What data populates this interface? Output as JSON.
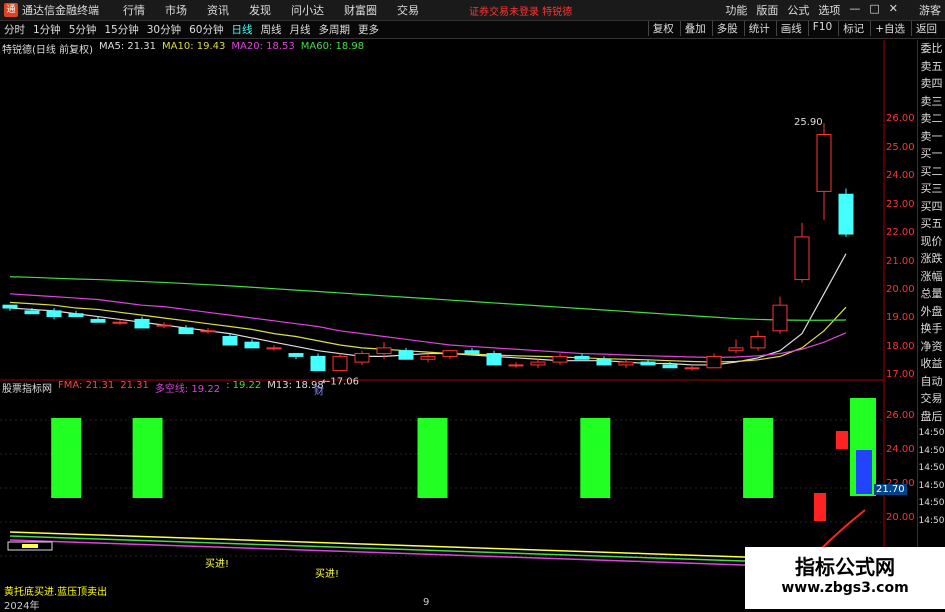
{
  "app": {
    "title": "通达信金融终端",
    "warning": "证券交易未登录 特锐德"
  },
  "menu": [
    "行情",
    "市场",
    "资讯",
    "发现",
    "问小达",
    "财富圈",
    "交易"
  ],
  "top_right": [
    "功能",
    "版面",
    "公式",
    "选项"
  ],
  "top_right_extra": "游客",
  "periods": [
    "分时",
    "1分钟",
    "5分钟",
    "15分钟",
    "30分钟",
    "60分钟",
    "日线",
    "周线",
    "月线",
    "多周期",
    "更多"
  ],
  "active_period": "日线",
  "tools": [
    "复权",
    "叠加",
    "多股",
    "统计",
    "画线",
    "F10",
    "标记",
    "+自选",
    "返回"
  ],
  "main_legend": {
    "name": "特锐德(日线 前复权)",
    "ma5": "MA5: 21.31",
    "ma10": "MA10: 19.43",
    "ma20": "MA20: 18.53",
    "ma60": "MA60: 18.98"
  },
  "sub_legend": {
    "name": "股票指标网",
    "fma": "FMA: 21.31",
    "v2": "21.31",
    "dk": "多空线: 19.22",
    "v4": ": 19.22",
    "m13": "M13: 18.98"
  },
  "price_ticks": [
    "26.00",
    "25.00",
    "24.00",
    "23.00",
    "22.00",
    "21.00",
    "20.00",
    "19.00",
    "18.00",
    "17.00"
  ],
  "sub_ticks": [
    "26.00",
    "24.00",
    "22.00",
    "20.00"
  ],
  "sub_current": "21.70",
  "side_items": [
    "委比",
    "卖五",
    "卖四",
    "卖三",
    "卖二",
    "卖一",
    "买一",
    "买二",
    "买三",
    "买四",
    "买五",
    "现价",
    "涨跌",
    "涨幅",
    "总量",
    "外盘",
    "换手",
    "净资",
    "收益",
    "自动",
    "交易",
    "盘后",
    "14:50",
    "14:50",
    "14:50",
    "14:50",
    "14:50",
    "14:50"
  ],
  "annotations": {
    "high": "25.90",
    "low": "17.06",
    "buy1": "买进!",
    "buy2": "买进!",
    "cai": "财"
  },
  "bottom_note": "黄托底买进.蓝压顶卖出",
  "dates": {
    "left": "2024年",
    "mid": "9"
  },
  "watermark": {
    "line1": "指标公式网",
    "line2": "www.zbgs3.com"
  },
  "chart_data": {
    "type": "candlestick",
    "ylim": [
      16.8,
      28.4
    ],
    "candles": [
      [
        19.5,
        19.5,
        19.3,
        19.4
      ],
      [
        19.3,
        19.4,
        19.2,
        19.2
      ],
      [
        19.3,
        19.4,
        19.0,
        19.1
      ],
      [
        19.2,
        19.3,
        19.1,
        19.1
      ],
      [
        19.0,
        19.1,
        18.9,
        18.9
      ],
      [
        18.9,
        19.0,
        18.8,
        18.9
      ],
      [
        19.0,
        19.1,
        18.7,
        18.7
      ],
      [
        18.8,
        18.9,
        18.7,
        18.8
      ],
      [
        18.7,
        18.8,
        18.5,
        18.5
      ],
      [
        18.6,
        18.7,
        18.5,
        18.6
      ],
      [
        18.4,
        18.5,
        18.1,
        18.1
      ],
      [
        18.2,
        18.3,
        18.0,
        18.0
      ],
      [
        18.0,
        18.1,
        17.9,
        18.0
      ],
      [
        17.8,
        17.8,
        17.6,
        17.7
      ],
      [
        17.7,
        17.8,
        17.2,
        17.2
      ],
      [
        17.2,
        17.8,
        17.2,
        17.7
      ],
      [
        17.5,
        17.9,
        17.4,
        17.8
      ],
      [
        17.8,
        18.2,
        17.6,
        18.0
      ],
      [
        17.9,
        18.0,
        17.6,
        17.6
      ],
      [
        17.6,
        17.8,
        17.5,
        17.7
      ],
      [
        17.7,
        17.9,
        17.6,
        17.9
      ],
      [
        17.9,
        18.0,
        17.8,
        17.8
      ],
      [
        17.8,
        17.9,
        17.4,
        17.4
      ],
      [
        17.4,
        17.5,
        17.3,
        17.4
      ],
      [
        17.4,
        17.6,
        17.3,
        17.5
      ],
      [
        17.5,
        17.8,
        17.4,
        17.7
      ],
      [
        17.7,
        17.8,
        17.6,
        17.6
      ],
      [
        17.6,
        17.7,
        17.4,
        17.4
      ],
      [
        17.4,
        17.6,
        17.3,
        17.5
      ],
      [
        17.5,
        17.6,
        17.4,
        17.4
      ],
      [
        17.4,
        17.5,
        17.3,
        17.3
      ],
      [
        17.3,
        17.4,
        17.2,
        17.3
      ],
      [
        17.3,
        17.8,
        17.3,
        17.7
      ],
      [
        17.9,
        18.3,
        17.8,
        18.0
      ],
      [
        18.0,
        18.6,
        17.9,
        18.4
      ],
      [
        18.6,
        19.8,
        18.5,
        19.5
      ],
      [
        20.4,
        22.4,
        20.3,
        21.9
      ],
      [
        23.5,
        25.9,
        22.5,
        25.5
      ],
      [
        23.4,
        23.6,
        21.9,
        22.0
      ]
    ],
    "ma_series": [
      {
        "name": "MA5",
        "color": "#dddddd",
        "values": [
          19.4,
          19.35,
          19.3,
          19.2,
          19.1,
          19.0,
          18.9,
          18.8,
          18.7,
          18.6,
          18.5,
          18.35,
          18.2,
          18.05,
          17.9,
          17.8,
          17.7,
          17.7,
          17.75,
          17.8,
          17.8,
          17.75,
          17.7,
          17.65,
          17.6,
          17.55,
          17.55,
          17.55,
          17.5,
          17.45,
          17.45,
          17.4,
          17.4,
          17.5,
          17.65,
          17.9,
          18.5,
          19.9,
          21.31
        ]
      },
      {
        "name": "MA10",
        "color": "#dddd44",
        "values": [
          19.6,
          19.55,
          19.5,
          19.4,
          19.35,
          19.25,
          19.15,
          19.05,
          18.95,
          18.85,
          18.75,
          18.65,
          18.5,
          18.4,
          18.25,
          18.1,
          18.0,
          17.95,
          17.9,
          17.85,
          17.8,
          17.78,
          17.75,
          17.72,
          17.7,
          17.68,
          17.65,
          17.62,
          17.6,
          17.58,
          17.55,
          17.52,
          17.5,
          17.52,
          17.58,
          17.7,
          18.0,
          18.6,
          19.43
        ]
      },
      {
        "name": "MA20",
        "color": "#dd44dd",
        "values": [
          19.9,
          19.85,
          19.8,
          19.75,
          19.7,
          19.6,
          19.5,
          19.45,
          19.35,
          19.25,
          19.15,
          19.05,
          18.95,
          18.85,
          18.75,
          18.6,
          18.5,
          18.4,
          18.3,
          18.2,
          18.1,
          18.05,
          18.0,
          17.95,
          17.9,
          17.85,
          17.8,
          17.78,
          17.75,
          17.72,
          17.7,
          17.68,
          17.66,
          17.68,
          17.72,
          17.8,
          17.95,
          18.2,
          18.53
        ]
      },
      {
        "name": "MA60",
        "color": "#44dd44",
        "values": [
          20.5,
          20.48,
          20.45,
          20.42,
          20.4,
          20.37,
          20.33,
          20.3,
          20.26,
          20.22,
          20.18,
          20.13,
          20.08,
          20.03,
          19.98,
          19.93,
          19.88,
          19.83,
          19.78,
          19.73,
          19.68,
          19.63,
          19.58,
          19.53,
          19.48,
          19.43,
          19.38,
          19.33,
          19.28,
          19.23,
          19.18,
          19.13,
          19.08,
          19.03,
          19.0,
          18.98,
          18.97,
          18.97,
          18.98
        ]
      }
    ],
    "sub_bars": [
      1,
      3,
      10,
      14,
      18,
      23,
      26,
      32
    ],
    "sub_red": [
      30,
      31
    ]
  }
}
